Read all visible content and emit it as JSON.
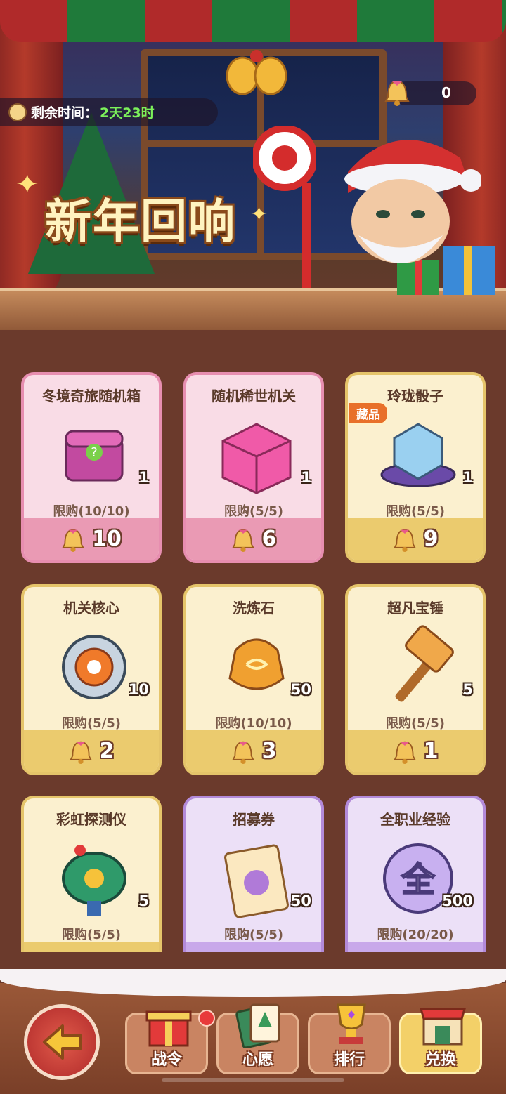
{
  "event": {
    "title": "新年回响",
    "timer_label": "剩余时间：",
    "timer_value": "2天23时",
    "currency_value": "0"
  },
  "shop": {
    "items": [
      {
        "name": "冬境奇旅随机箱",
        "qty": "1",
        "limit": "限购(10/10)",
        "price": "10",
        "style": "pink",
        "badge": ""
      },
      {
        "name": "随机稀世机关",
        "qty": "1",
        "limit": "限购(5/5)",
        "price": "6",
        "style": "pink",
        "badge": ""
      },
      {
        "name": "玲珑骰子",
        "qty": "1",
        "limit": "限购(5/5)",
        "price": "9",
        "style": "yellow",
        "badge": "藏品"
      },
      {
        "name": "机关核心",
        "qty": "10",
        "limit": "限购(5/5)",
        "price": "2",
        "style": "yellow",
        "badge": ""
      },
      {
        "name": "洗炼石",
        "qty": "50",
        "limit": "限购(10/10)",
        "price": "3",
        "style": "yellow",
        "badge": ""
      },
      {
        "name": "超凡宝锤",
        "qty": "5",
        "limit": "限购(5/5)",
        "price": "1",
        "style": "yellow",
        "badge": ""
      },
      {
        "name": "彩虹探测仪",
        "qty": "5",
        "limit": "限购(5/5)",
        "price": "",
        "style": "yellow",
        "badge": ""
      },
      {
        "name": "招募券",
        "qty": "50",
        "limit": "限购(5/5)",
        "price": "",
        "style": "purple",
        "badge": ""
      },
      {
        "name": "全职业经验",
        "qty": "500",
        "limit": "限购(20/20)",
        "price": "",
        "style": "purple",
        "badge": ""
      }
    ]
  },
  "nav": {
    "tabs": [
      {
        "label": "战令",
        "icon": "gift-box-icon"
      },
      {
        "label": "心愿",
        "icon": "wish-card-icon"
      },
      {
        "label": "排行",
        "icon": "trophy-icon"
      },
      {
        "label": "兑换",
        "icon": "shop-icon"
      }
    ],
    "active": "兑换"
  },
  "colors": {
    "pink_card": "#f9dce6",
    "yellow_card": "#fbf0cf",
    "purple_card": "#ece0f7",
    "timer_green": "#7cf05a"
  }
}
